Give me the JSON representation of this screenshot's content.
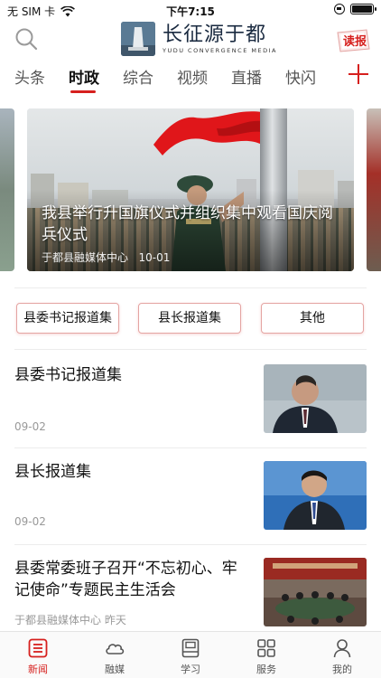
{
  "status_bar": {
    "carrier": "无 SIM 卡",
    "time": "下午7:15"
  },
  "header": {
    "logo_title": "长征源于都",
    "logo_subtitle": "YUDU CONVERGENCE MEDIA",
    "read_paper_label": "读报"
  },
  "tabs": [
    {
      "label": "头条"
    },
    {
      "label": "时政"
    },
    {
      "label": "综合"
    },
    {
      "label": "视频"
    },
    {
      "label": "直播"
    },
    {
      "label": "快闪"
    }
  ],
  "active_tab": "时政",
  "banner": {
    "title": "我县举行升国旗仪式并组织集中观看国庆阅兵仪式",
    "source": "于都县融媒体中心",
    "date": "10-01"
  },
  "categories": [
    {
      "label": "县委书记报道集"
    },
    {
      "label": "县长报道集"
    },
    {
      "label": "其他"
    }
  ],
  "news": [
    {
      "title": "县委书记报道集",
      "meta": "09-02"
    },
    {
      "title": "县长报道集",
      "meta": "09-02"
    },
    {
      "title": "县委常委班子召开“不忘初心、牢记使命”专题民主生活会",
      "meta": "于都县融媒体中心  昨天"
    }
  ],
  "bottom_nav": [
    {
      "label": "新闻"
    },
    {
      "label": "融媒"
    },
    {
      "label": "学习"
    },
    {
      "label": "服务"
    },
    {
      "label": "我的"
    }
  ],
  "active_nav": "新闻",
  "colors": {
    "accent": "#d6201e",
    "text": "#111111",
    "muted": "#999999"
  }
}
